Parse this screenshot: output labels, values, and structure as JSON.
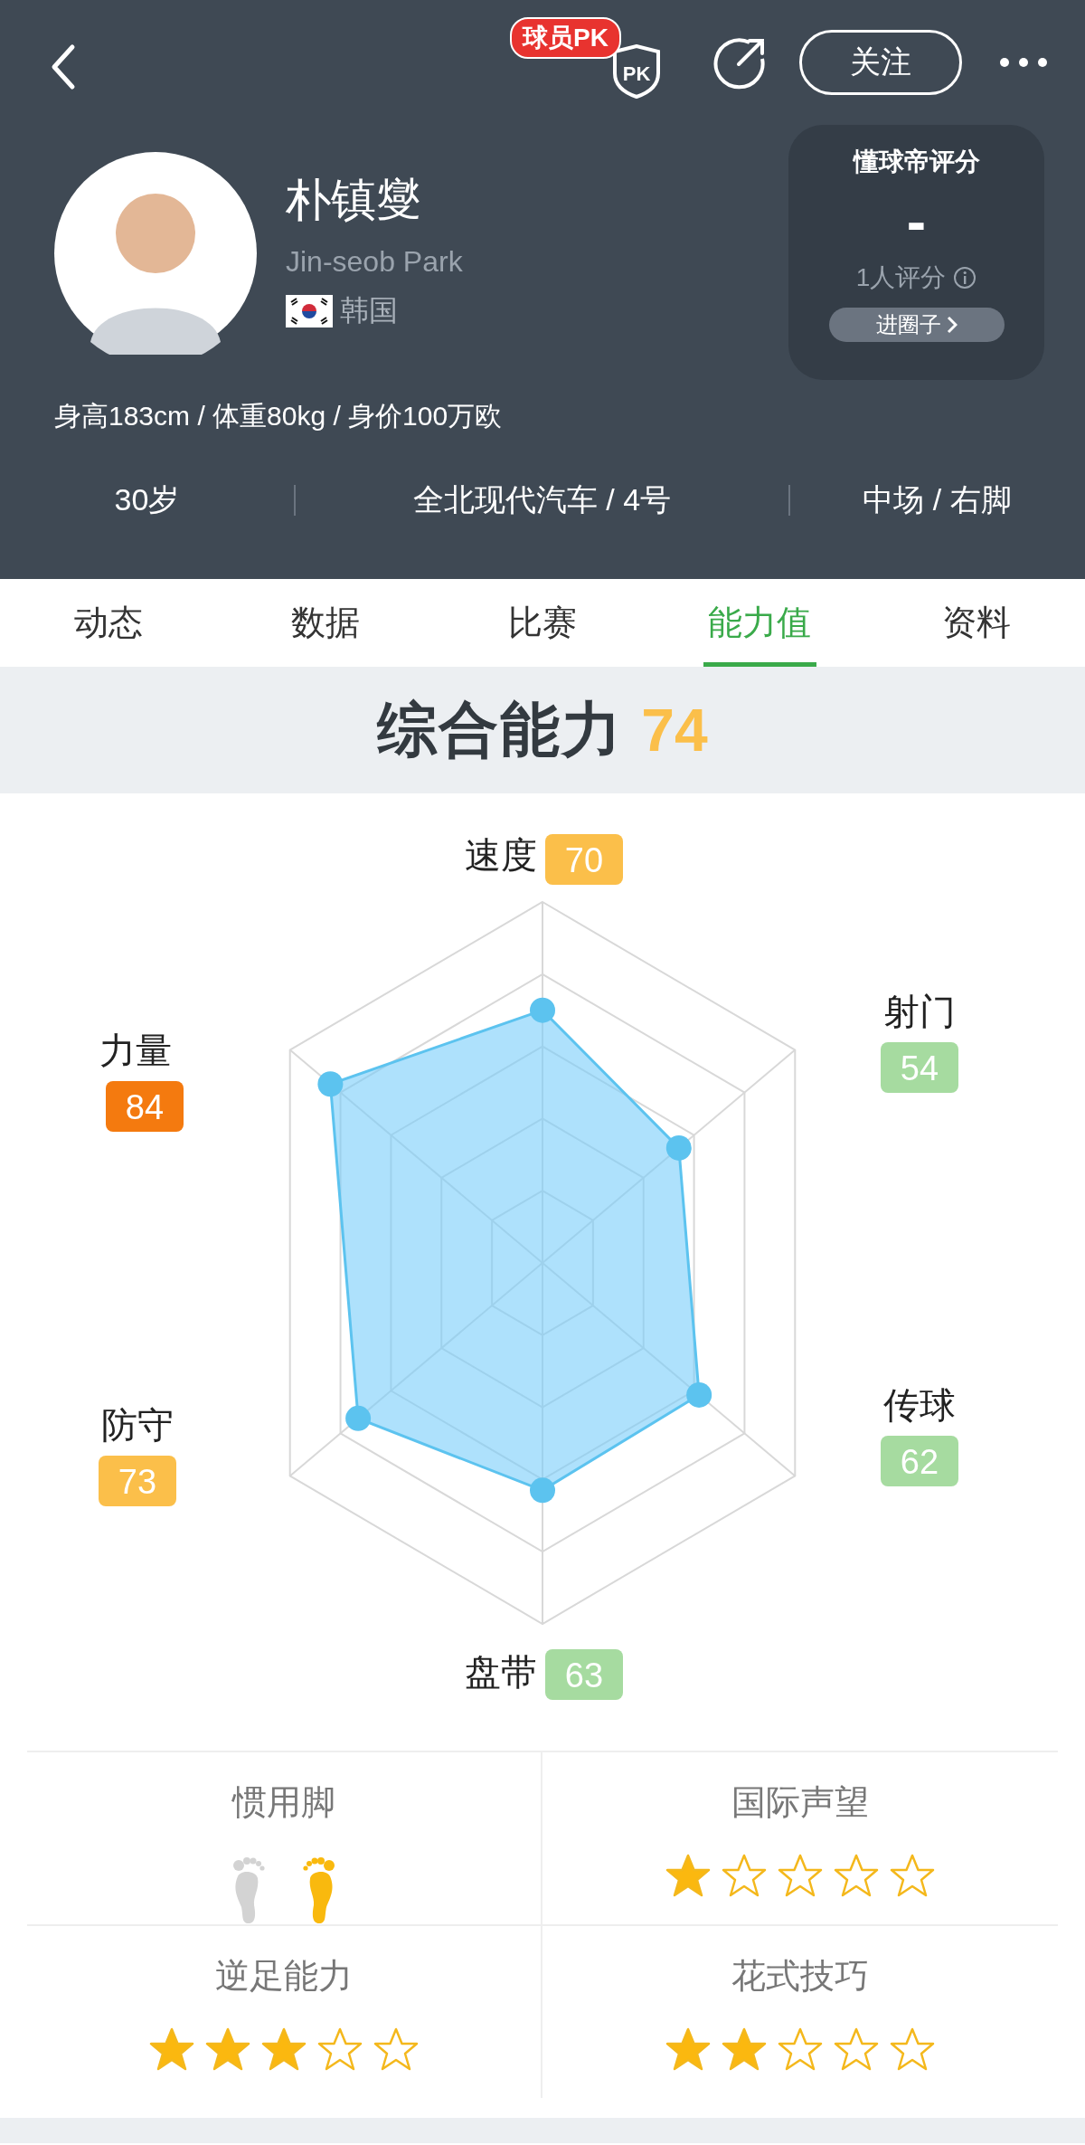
{
  "header": {
    "pk_badge": "球员PK",
    "pk_label": "PK",
    "follow_button": "关注"
  },
  "player": {
    "name": "朴镇燮",
    "english_name": "Jin-seob Park",
    "country": "韩国",
    "info": "身高183cm / 体重80kg / 身价100万欧"
  },
  "rating_card": {
    "title": "懂球帝评分",
    "score": "-",
    "count": "1人评分",
    "link": "进圈子"
  },
  "stats": [
    "30岁",
    "全北现代汽车 / 4号",
    "中场 / 右脚"
  ],
  "tabs": [
    {
      "label": "动态",
      "selected": false
    },
    {
      "label": "数据",
      "selected": false
    },
    {
      "label": "比赛",
      "selected": false
    },
    {
      "label": "能力值",
      "selected": true
    },
    {
      "label": "资料",
      "selected": false
    }
  ],
  "overall": {
    "label": "综合能力",
    "value": "74"
  },
  "attributes": [
    {
      "name": "速度",
      "value": "70",
      "color": "#fbbf4a"
    },
    {
      "name": "射门",
      "value": "54",
      "color": "#a6dba0"
    },
    {
      "name": "传球",
      "value": "62",
      "color": "#a6dba0"
    },
    {
      "name": "盘带",
      "value": "63",
      "color": "#a6dba0"
    },
    {
      "name": "防守",
      "value": "73",
      "color": "#fbbf4a"
    },
    {
      "name": "力量",
      "value": "84",
      "color": "#f47a0f"
    }
  ],
  "traits": [
    {
      "kind": "feet",
      "title": "惯用脚",
      "feet": [
        {
          "used": false
        },
        {
          "used": true
        }
      ]
    },
    {
      "kind": "stars",
      "title": "国际声望",
      "stars": 1
    },
    {
      "kind": "stars",
      "title": "逆足能力",
      "stars": 3
    },
    {
      "kind": "stars",
      "title": "花式技巧",
      "stars": 2
    }
  ]
}
